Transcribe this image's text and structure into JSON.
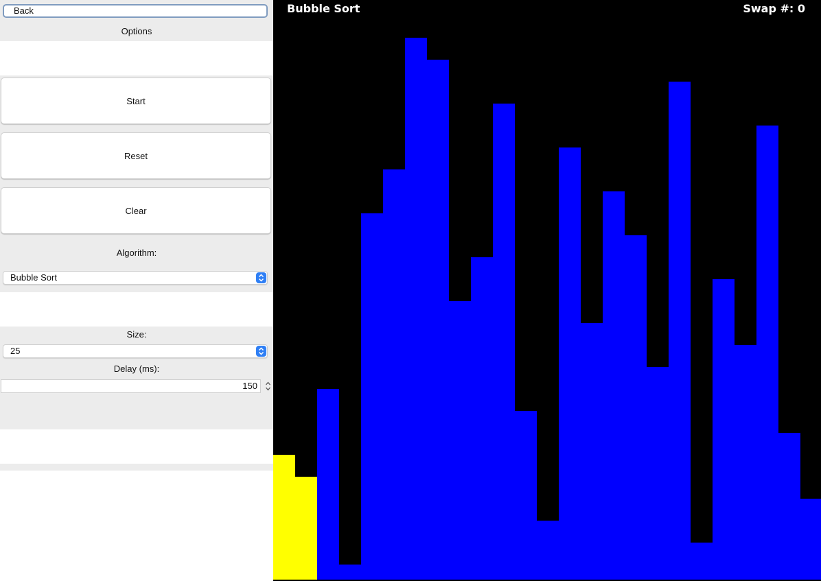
{
  "sidebar": {
    "back_label": "Back",
    "options_label": "Options",
    "start_label": "Start",
    "reset_label": "Reset",
    "clear_label": "Clear",
    "algorithm_label": "Algorithm:",
    "algorithm_value": "Bubble Sort",
    "size_label": "Size:",
    "size_value": "25",
    "delay_label": "Delay (ms):",
    "delay_value": "150"
  },
  "canvas": {
    "title": "Bubble Sort",
    "swap_text": "Swap #: 0"
  },
  "colors": {
    "bar": "#0000ff",
    "active_bar": "#ffff00",
    "background": "#000000",
    "accent": "#2f7ff5"
  },
  "chart_data": {
    "type": "bar",
    "values": [
      182,
      150,
      278,
      22,
      534,
      598,
      790,
      758,
      406,
      470,
      694,
      246,
      86,
      630,
      374,
      566,
      502,
      310,
      726,
      54,
      438,
      342,
      662,
      214,
      118
    ],
    "highlighted": [
      0,
      1
    ],
    "max_value": 790
  }
}
